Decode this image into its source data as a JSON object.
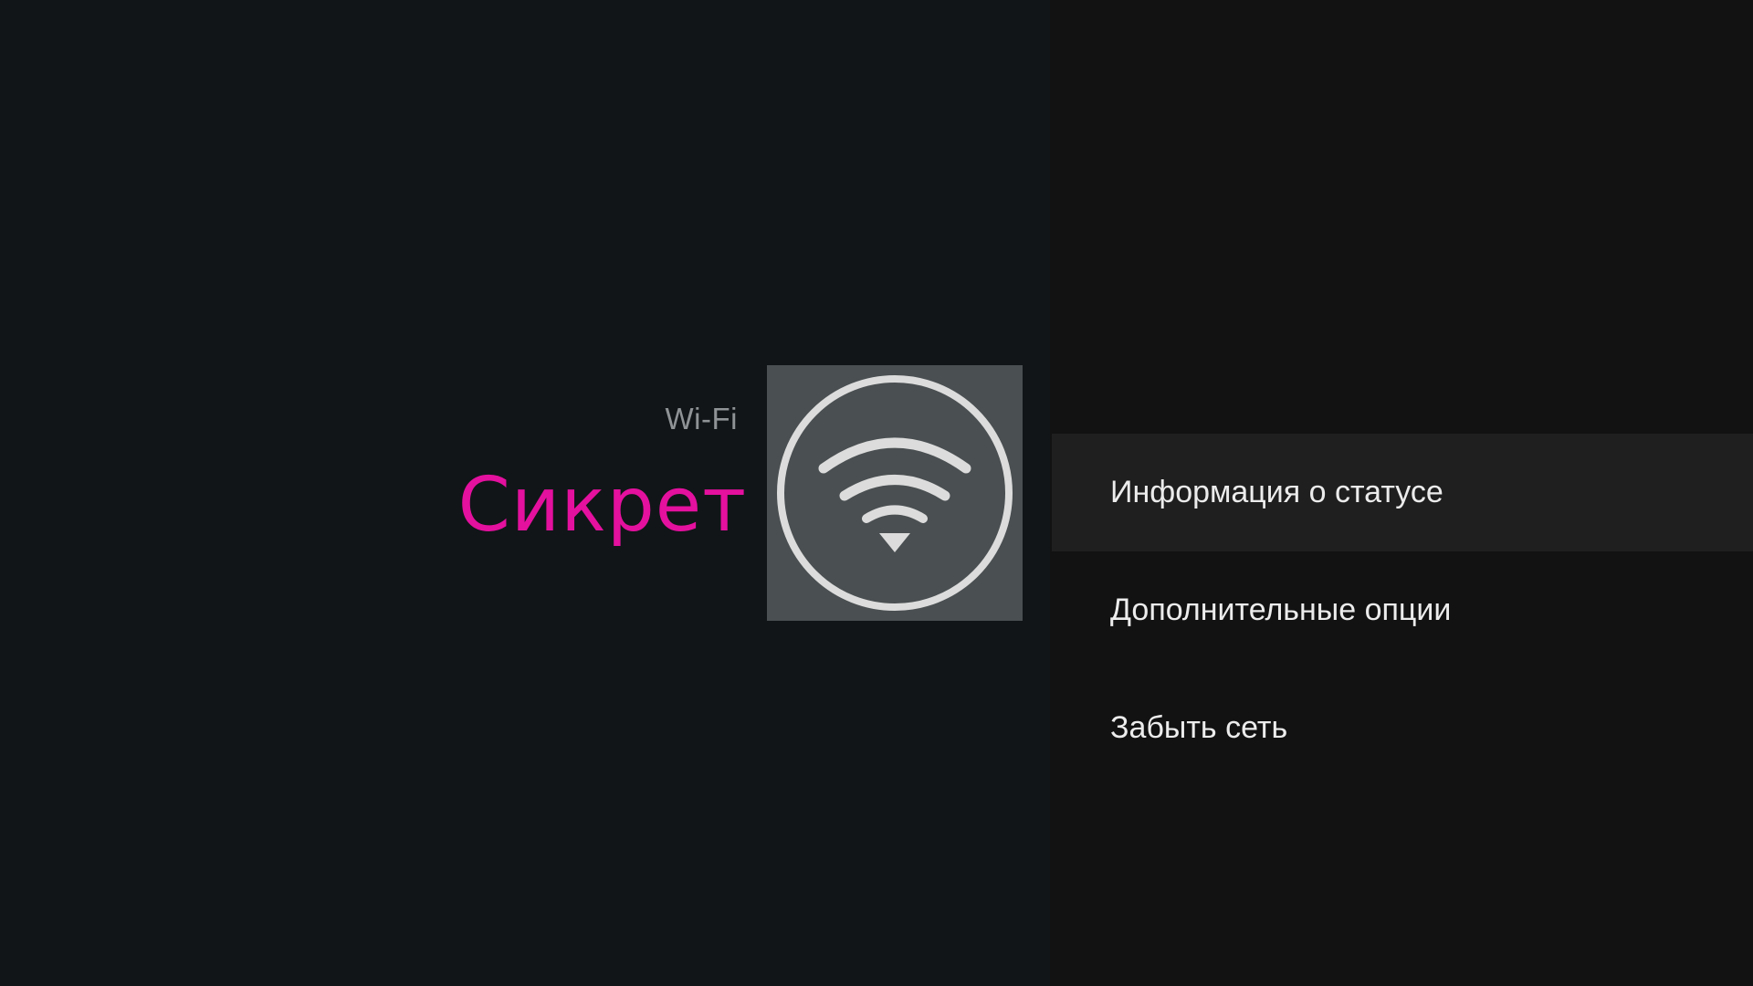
{
  "header": {
    "section_label": "Wi-Fi",
    "network_name": "Сикрет"
  },
  "icon": {
    "name": "wifi-signal-icon",
    "tile_color": "#4a4f51",
    "stroke_color": "#dcdcdc"
  },
  "colors": {
    "accent": "#e4109e",
    "left_bg": "#111518",
    "right_bg": "#121212",
    "focused_bg": "#1f1f1f"
  },
  "menu": {
    "items": [
      {
        "label": "Информация о статусе",
        "focused": true
      },
      {
        "label": "Дополнительные опции",
        "focused": false
      },
      {
        "label": "Забыть сеть",
        "focused": false
      }
    ]
  }
}
